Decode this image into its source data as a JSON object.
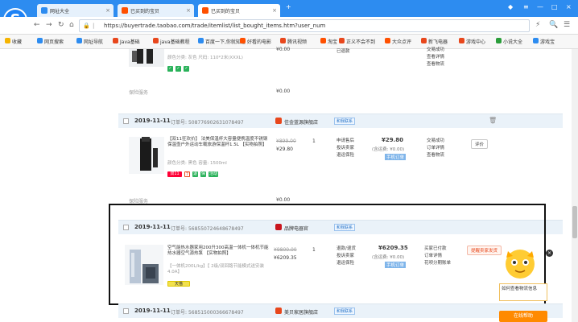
{
  "browser": {
    "tabs": [
      {
        "title": "网址大全",
        "color": "#2d8cf0"
      },
      {
        "title": "已买到的宝贝",
        "color": "#ff5000"
      },
      {
        "title": "已买到的宝贝",
        "color": "#ff5000"
      }
    ],
    "url": "https://buyertrade.taobao.com/trade/itemlist/list_bought_items.htm?user_num",
    "bookmarks": [
      "收藏",
      "网页搜索",
      "网址导航",
      "Java基础",
      "java基础教程",
      "百度一下,你就知道",
      "好看的电影",
      "腾讯视频",
      "淘宝",
      "正义不会不到",
      "大众点评",
      "新飞电器",
      "游戏中心",
      "小说大全",
      "游戏宝"
    ]
  },
  "orders": [
    {
      "product_specs": "颜色分类: 灰色 尺码: 110*2米(XXXL)",
      "item_price": "¥0.00",
      "insurance_label": "保险服务",
      "insurance_price": "¥0.00",
      "order_status_lines": [
        "交易成功",
        "查看详情",
        "查看物流"
      ],
      "refund_label": "已退款",
      "header_badge": null
    },
    {
      "date": "2019-11-11",
      "order_no_label": "订单号:",
      "order_no": "508776902631078497",
      "shop": "佳金蓝源旗舰店",
      "contact_label": "和我联系",
      "product_name": "【双11狂欢价】 法美保温杯大容量便携温度不锈钢保温壶户外运动车载旅游保温杯1.5L 【实物拍照】",
      "product_specs": "颜色分类: 黑色 容量: 1500ml",
      "tags": [
        "双11",
        "7",
        "退",
        "保",
        "活动"
      ],
      "orig_price": "¥899.00",
      "price": "¥29.80",
      "qty": "1",
      "service": [
        "申请售后",
        "投诉卖家",
        "退运保险"
      ],
      "total": "¥29.80",
      "shipping": "(含运费: ¥0.00)",
      "pay_method": "手机订单",
      "status": [
        "交易成功",
        "订单详情",
        "查看物流"
      ],
      "button": "评价",
      "insurance_label": "保险服务",
      "insurance_price": "¥0.00"
    },
    {
      "date": "2019-11-11",
      "order_no_label": "订单号:",
      "order_no": "568550724648678497",
      "shop": "品牌电器官",
      "contact_label": "和我联系",
      "product_name": "空气能热水器家用200升300高温一体机一体机节能热水器空气源热泵 【实物拍照】",
      "product_specs": "【一体机200L/kg】【 2级/双回路节能模式送安装4.0A】",
      "tag": "天猫",
      "orig_price": "¥9800.00",
      "price": "¥6209.35",
      "qty": "1",
      "service": [
        "退款/退货",
        "投诉卖家",
        "退运保险"
      ],
      "total": "¥6209.35",
      "shipping": "(含运费: ¥0.00)",
      "pay_method": "手机订单",
      "status": [
        "买家已付款",
        "订单详情",
        "花呗分期账单"
      ],
      "alert_status": "提醒卖家发货"
    },
    {
      "date": "2019-11-11",
      "order_no_label": "订单号:",
      "order_no": "568515000366678497",
      "shop": "美贝家居旗舰店",
      "contact_label": "和我联系"
    }
  ],
  "helper": {
    "tip_text": "如何查看物流信息",
    "button": "在线帮助"
  }
}
